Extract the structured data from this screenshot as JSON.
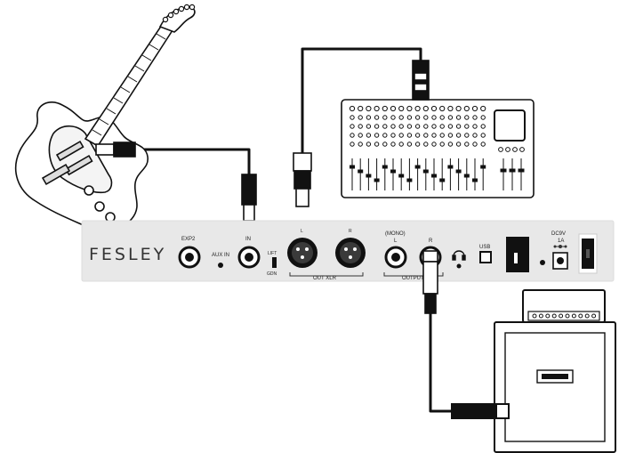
{
  "brand": "FESLEY",
  "panel_labels": {
    "exp": "EXP2",
    "aux_in": "AUX IN",
    "in": "IN",
    "lift": "LIFT",
    "gnd": "GDN",
    "xlr_l": "L",
    "xlr_r": "R",
    "out_xlr": "OUT XLR",
    "mono": "(MONO)",
    "out_l": "L",
    "out_r": "R",
    "output": "OUTPUT",
    "usb": "USB",
    "dc": "DC9V",
    "amp": "1A"
  }
}
